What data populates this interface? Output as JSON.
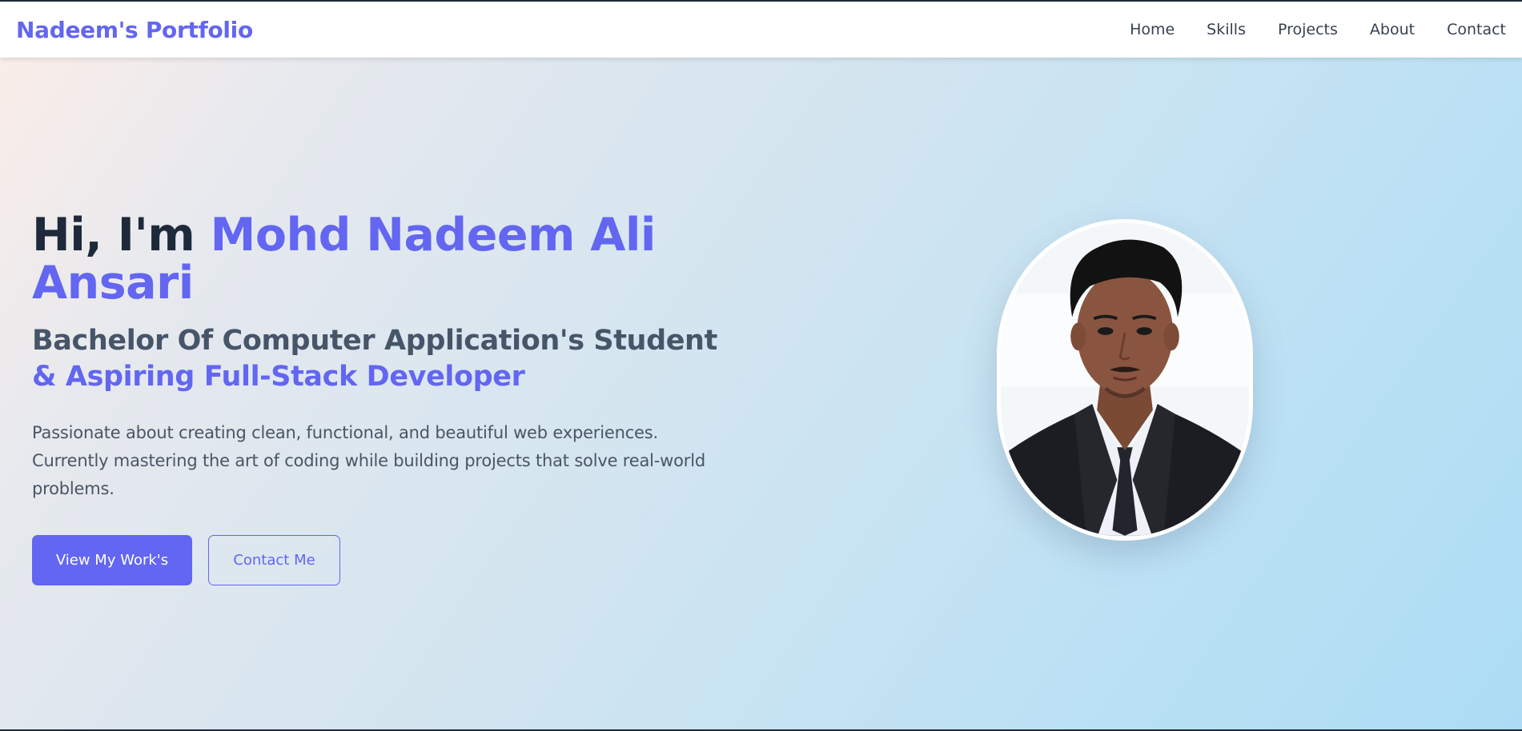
{
  "navbar": {
    "brand": "Nadeem's Portfolio",
    "links": [
      "Home",
      "Skills",
      "Projects",
      "About",
      "Contact"
    ]
  },
  "hero": {
    "greeting": "Hi, I'm ",
    "name": "Mohd Nadeem Ali Ansari",
    "subtitle_line1": "Bachelor Of Computer Application's Student",
    "subtitle_line2": "& Aspiring Full-Stack Developer",
    "description": "Passionate about creating clean, functional, and beautiful web experiences. Currently mastering the art of coding while building projects that solve real-world problems.",
    "primary_button": "View My Work's",
    "secondary_button": "Contact Me"
  },
  "colors": {
    "accent": "#6366f1",
    "heading": "#1e293b",
    "text": "#4b5563"
  }
}
